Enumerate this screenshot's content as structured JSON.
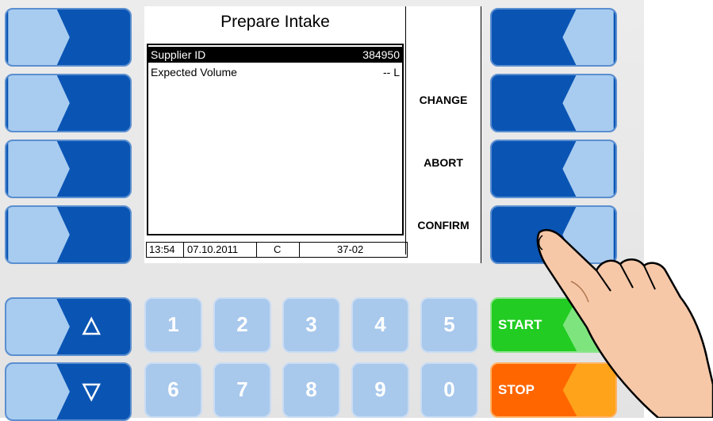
{
  "screen": {
    "title": "Prepare Intake",
    "rows": [
      {
        "label": "Supplier ID",
        "value": "384950",
        "selected": true
      },
      {
        "label": "Expected Volume",
        "value": "-- L",
        "selected": false
      }
    ],
    "softkeys": [
      "CHANGE",
      "ABORT",
      "CONFIRM"
    ],
    "status": {
      "time": "13:54",
      "date": "07.10.2011",
      "mode": "C",
      "code": "37-02"
    }
  },
  "keypad": {
    "up_icon": "up-triangle-icon",
    "down_icon": "down-triangle-icon",
    "row1": [
      "1",
      "2",
      "3",
      "4",
      "5"
    ],
    "row2": [
      "6",
      "7",
      "8",
      "9",
      "0"
    ],
    "start_label": "START",
    "stop_label": "STOP"
  },
  "colors": {
    "key_blue": "#0a55b4",
    "key_light": "#a8c8ec",
    "start_green": "#22cc22",
    "stop_orange": "#ff6600"
  }
}
